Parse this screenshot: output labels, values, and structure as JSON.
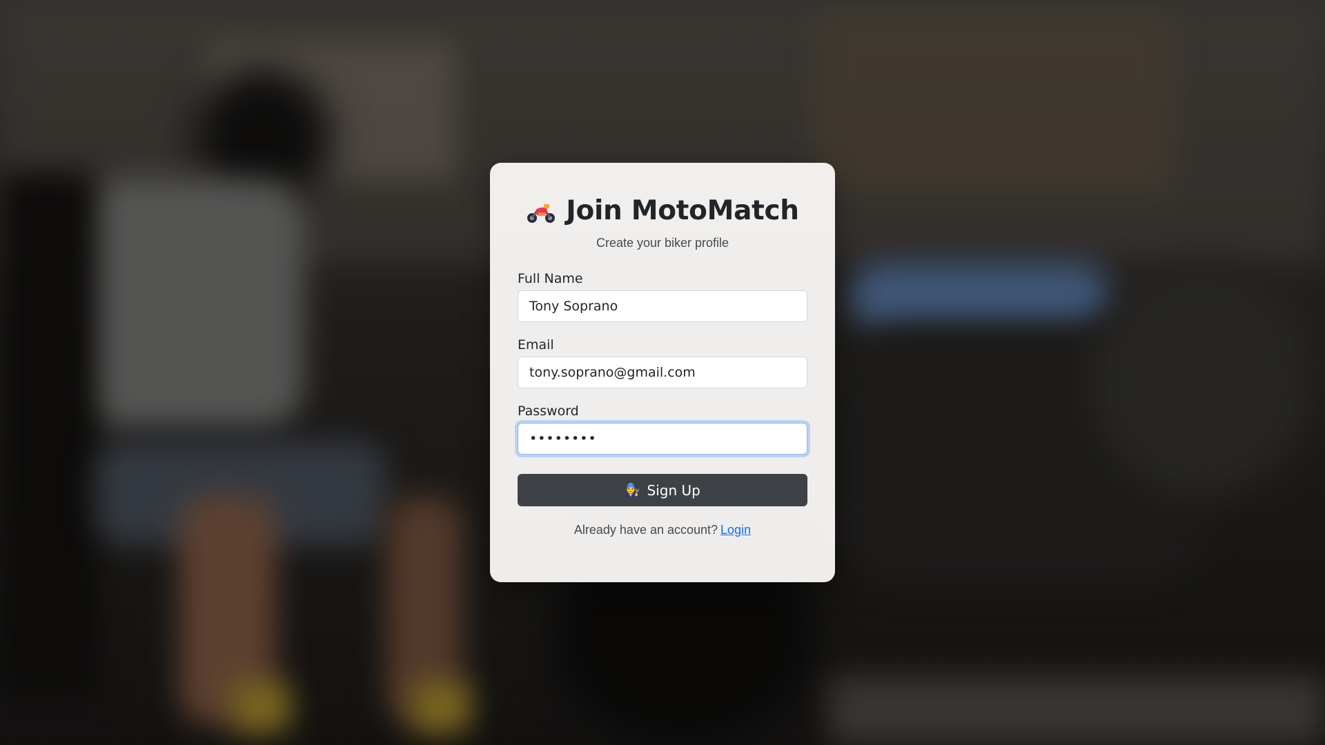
{
  "page": {
    "title": "Join MotoMatch",
    "subtitle": "Create your biker profile",
    "title_icon": "motorcycle-icon"
  },
  "form": {
    "full_name": {
      "label": "Full Name",
      "value": "Tony Soprano"
    },
    "email": {
      "label": "Email",
      "value": "tony.soprano@gmail.com"
    },
    "password": {
      "label": "Password",
      "value": "••••••••",
      "focused": true
    },
    "submit": {
      "label": "Sign Up",
      "icon": "mechanic-icon"
    }
  },
  "footer": {
    "text": "Already have an account?",
    "link_label": "Login"
  },
  "colors": {
    "button_bg": "#3e4246",
    "link": "#0d6efd",
    "focus_ring": "#86b7fe"
  }
}
